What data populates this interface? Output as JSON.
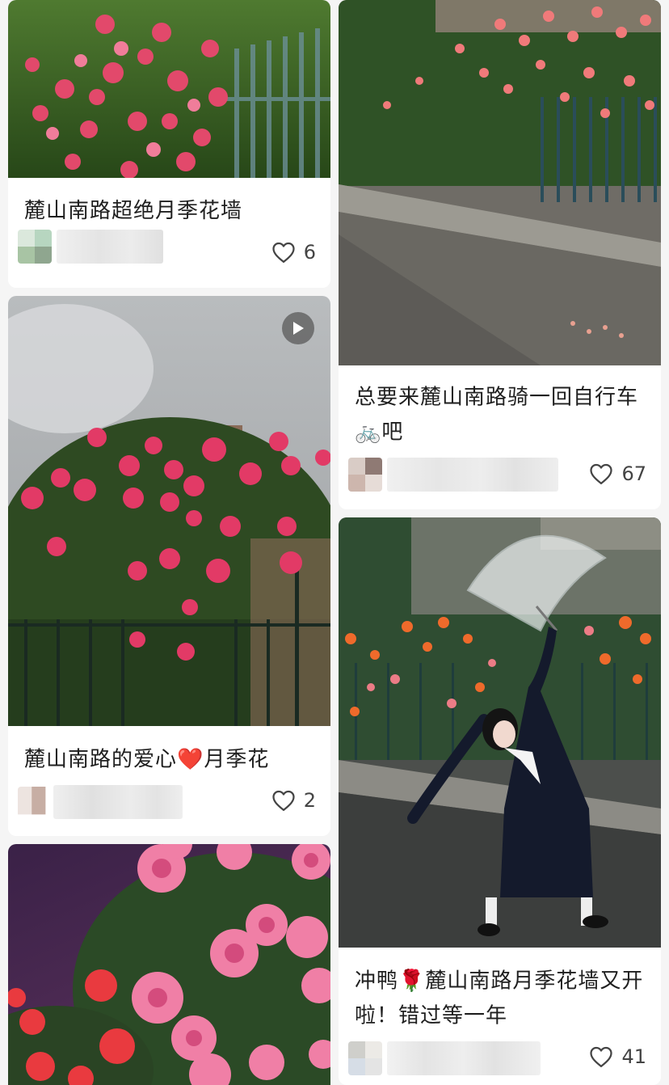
{
  "feed": {
    "cards": [
      {
        "title": "麓山南路超绝月季花墙",
        "likes": "6"
      },
      {
        "title_part1": "总要来麓山南路骑一回自行车",
        "emoji": "🚲",
        "title_part2": "吧",
        "likes": "67"
      },
      {
        "title_part1": "麓山南路的爱心",
        "emoji": "❤️",
        "title_part2": "月季花",
        "likes": "2"
      },
      {
        "title_part1": "冲鸭",
        "emoji": "🌹",
        "title_part2": "麓山南路月季花墙又开啦！错过等一年",
        "likes": "41"
      },
      {
        "title": ""
      }
    ],
    "icons": {
      "like": "heart-outline-icon",
      "video": "play-icon"
    },
    "colors": {
      "text": "#1f1f1f",
      "likes_text": "#444444",
      "background": "#f5f5f5"
    }
  }
}
